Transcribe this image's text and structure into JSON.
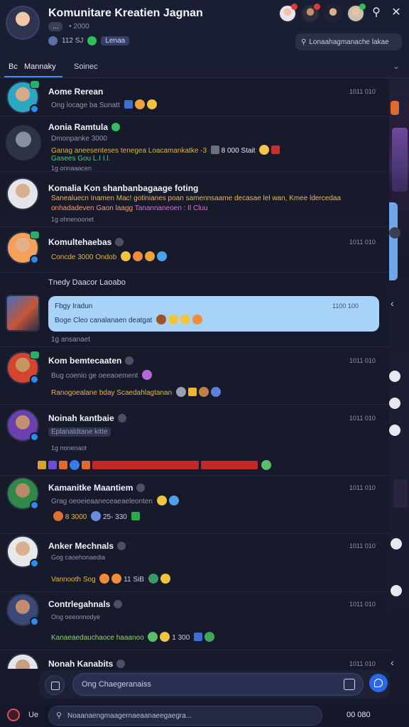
{
  "header": {
    "title": "Komunitare Kreatien Jagnan",
    "subtitle_pill": "...",
    "subtitle": "• 2000",
    "members": "112 SJ",
    "tag": "Lenaa",
    "pinned": "Lonaahagmanache lakae"
  },
  "tabs": [
    {
      "label": "Mannaky",
      "prefix": "Bc"
    },
    {
      "label": "Soinec"
    }
  ],
  "messages": [
    {
      "name": "Aome Rerean",
      "time": "1011 010",
      "lines": [
        "Ong locage ba Sunatt"
      ]
    },
    {
      "name": "Aonia Ramtula",
      "time": "",
      "lines": [
        "Dmonpanke 3000",
        "Ganag aneesenteses tenegea Loacamankatke -3",
        "Gasees Gou L.I I.l.",
        "1g onnaaacen"
      ]
    },
    {
      "name": "Komalia Kon shanbanbagaage foting",
      "time": "",
      "lines": [
        "Sanealuecn Inamen Mac! gotinianes poan samennsaame decasae lel wan, Kmee ldercedaa",
        "onhadadeven Gaon laagg",
        "Tanannaneoen : Il Cluu",
        "1g ohnenoonet"
      ]
    },
    {
      "name": "Komultehaebas",
      "time": "1011 010",
      "lines": [
        "Concde 3000 Ondob"
      ]
    },
    {
      "name": "Kom bemtecaaten",
      "time": "1011 010",
      "lines": [
        "Bug coenio ge oeeaoement",
        "Ranogoealane bday Scaedahlagtanan"
      ]
    },
    {
      "name": "Noinah kantbaie",
      "time": "1011 010",
      "lines": [
        "Eplanaldtane kitte",
        "1g nonenaot"
      ]
    },
    {
      "name": "Kamanitke Maantiem",
      "time": "1011 010",
      "lines": [
        "Grag oeoeieaaneceaeaeleonten",
        "8 3000",
        "25- 330"
      ]
    },
    {
      "name": "Anker Mechnals",
      "time": "1011 010",
      "lines": [
        "Gog caoehonaedia",
        "Vannooth Sog",
        "11 SiB"
      ]
    },
    {
      "name": "Contrlegahnals",
      "time": "1011 010",
      "lines": [
        "Ong oeeonnodye",
        "Kanaeaedauchaoce haaanoo",
        "1 300"
      ]
    },
    {
      "name": "Nonah Kanabits",
      "time": "1011 010",
      "lines": []
    }
  ],
  "section": {
    "title": "Tnedy Daacor Laoabo",
    "bubble_name": "Fbgy Iradun",
    "bubble_time": "1100 100",
    "bubble_text": "Boge Cleo canalanaen deatgat",
    "after": "1g ansanaet"
  },
  "extra_text": {
    "m2_tail": "8 000 Stait",
    "m7_meta": "8 000 Stait"
  },
  "composer": {
    "placeholder": "Ong Chaegeranaiss"
  },
  "bottom_bar": {
    "label": "Ue",
    "search_placeholder": "Noaanaengmaagernaeaanaeegaegra...",
    "right": "00  080"
  },
  "colors": {
    "background": "#161a2b",
    "accent": "#3f8ff0",
    "bubble": "#a7d3fb",
    "send": "#2c68e6"
  }
}
